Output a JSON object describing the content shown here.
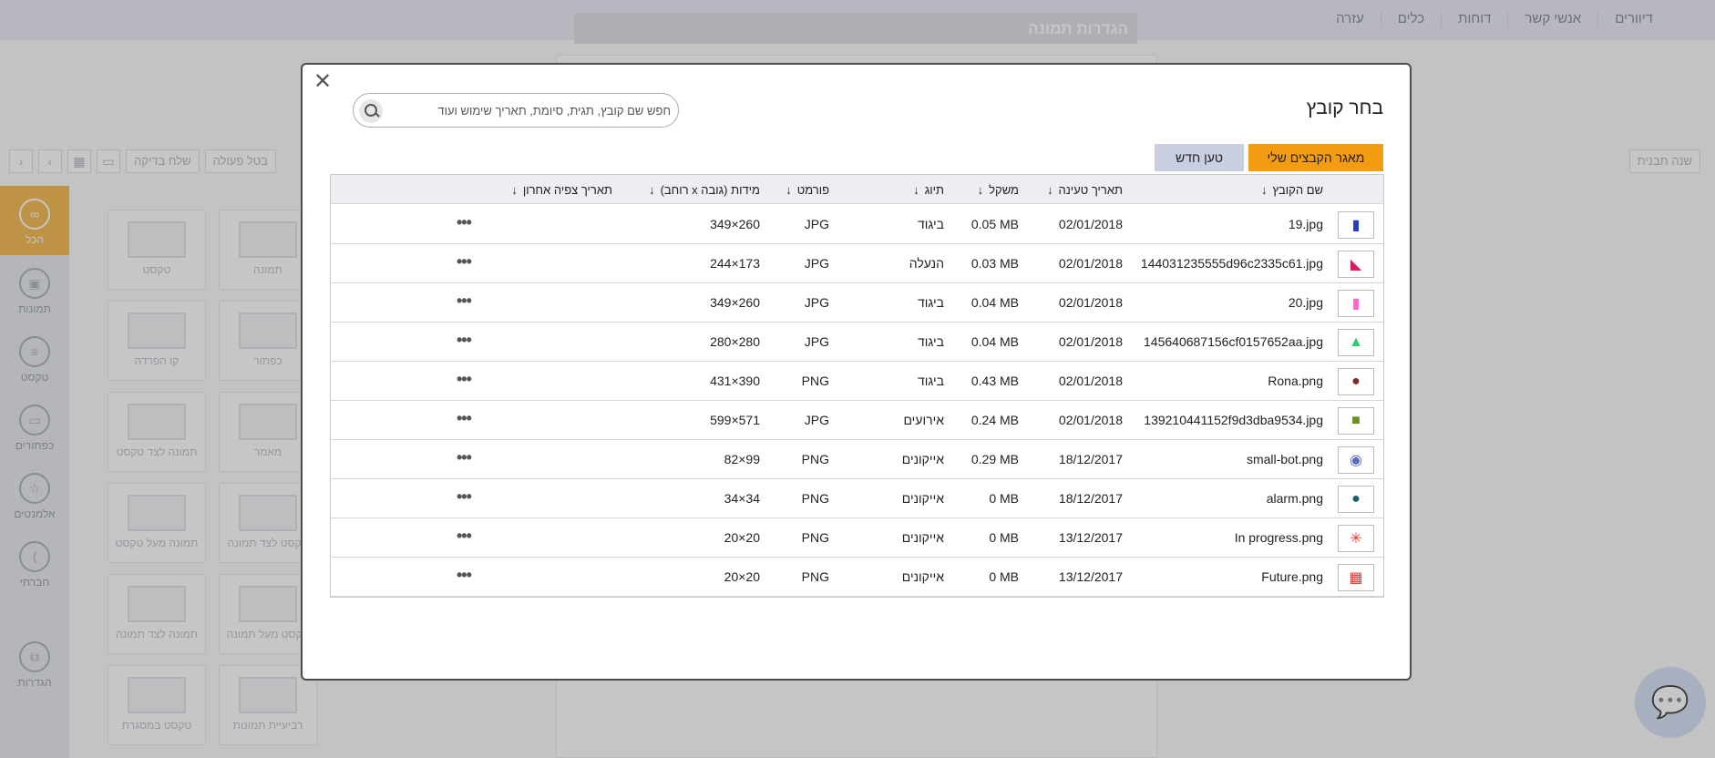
{
  "nav": [
    "דיוורים",
    "אנשי קשר",
    "דוחות",
    "כלים",
    "עזרה"
  ],
  "settings_panel_title": "הגדרות תמונה",
  "toolbar": {
    "test_send": "שלח בדיקה",
    "cancel_action": "בטל פעולה",
    "change_template": "שנה תבנית"
  },
  "rail": [
    {
      "label": "הכל",
      "icon": "infinity-icon"
    },
    {
      "label": "תמונות",
      "icon": "image-icon"
    },
    {
      "label": "טקסט",
      "icon": "text-icon"
    },
    {
      "label": "כפתורים",
      "icon": "button-icon"
    },
    {
      "label": "אלמנטים",
      "icon": "star-icon"
    },
    {
      "label": "חברתי",
      "icon": "share-icon"
    },
    {
      "label": "הגדרות",
      "icon": "settings-icon"
    }
  ],
  "widgets": [
    "תמונה",
    "טקסט",
    "כפתור",
    "קו הפרדה",
    "מאמר",
    "תמונה לצד טקסט",
    "טקסט לצד תמונה",
    "תמונה מעל טקסט",
    "טקסט מעל תמונה",
    "תמונה לצד תמונה",
    "רביעיית תמונות",
    "טקסט במסגרת"
  ],
  "modal": {
    "title": "בחר קובץ",
    "search_placeholder": "חפש שם קובץ, תגית, סיומת, תאריך שימוש ועוד",
    "btn_my_files": "מאגר הקבצים שלי",
    "btn_upload": "טען חדש",
    "columns": {
      "name": "שם הקובץ",
      "upload_date": "תאריך טעינה",
      "size": "משקל",
      "tag": "תיוג",
      "format": "פורמט",
      "dims": "מידות (גובה x רוחב)",
      "last_viewed": "תאריך צפיה אחרון"
    },
    "sort_arrow": "↓",
    "more": "•••",
    "rows": [
      {
        "name": "19.jpg",
        "date": "02/01/2018",
        "size": "0.05 MB",
        "tag": "ביגוד",
        "format": "JPG",
        "dims": "349×260",
        "thumb_color": "#1f3fbf",
        "thumb_glyph": "▮",
        "thumb_icon": "dress-icon"
      },
      {
        "name": "144031235555d96c2335c61.jpg",
        "date": "02/01/2018",
        "size": "0.03 MB",
        "tag": "הנעלה",
        "format": "JPG",
        "dims": "244×173",
        "thumb_color": "#d81b60",
        "thumb_glyph": "◣",
        "thumb_icon": "shoe-icon"
      },
      {
        "name": "20.jpg",
        "date": "02/01/2018",
        "size": "0.04 MB",
        "tag": "ביגוד",
        "format": "JPG",
        "dims": "349×260",
        "thumb_color": "#ff66cc",
        "thumb_glyph": "▮",
        "thumb_icon": "shirt-icon"
      },
      {
        "name": "145640687156cf0157652aa.jpg",
        "date": "02/01/2018",
        "size": "0.04 MB",
        "tag": "ביגוד",
        "format": "JPG",
        "dims": "280×280",
        "thumb_color": "#2ecc71",
        "thumb_glyph": "▲",
        "thumb_icon": "dress-icon"
      },
      {
        "name": "Rona.png",
        "date": "02/01/2018",
        "size": "0.43 MB",
        "tag": "ביגוד",
        "format": "PNG",
        "dims": "431×390",
        "thumb_color": "#7a2a2a",
        "thumb_glyph": "●",
        "thumb_icon": "portrait-icon"
      },
      {
        "name": "139210441152f9d3dba9534.jpg",
        "date": "02/01/2018",
        "size": "0.24 MB",
        "tag": "אירועים",
        "format": "JPG",
        "dims": "599×571",
        "thumb_color": "#6b8e23",
        "thumb_glyph": "■",
        "thumb_icon": "photo-icon"
      },
      {
        "name": "small-bot.png",
        "date": "18/12/2017",
        "size": "0.29 MB",
        "tag": "אייקונים",
        "format": "PNG",
        "dims": "82×99",
        "thumb_color": "#5c6bc0",
        "thumb_glyph": "◉",
        "thumb_icon": "bot-icon"
      },
      {
        "name": "alarm.png",
        "date": "18/12/2017",
        "size": "0 MB",
        "tag": "אייקונים",
        "format": "PNG",
        "dims": "34×34",
        "thumb_color": "#1e5d6b",
        "thumb_glyph": "●",
        "thumb_icon": "bell-icon"
      },
      {
        "name": "In progress.png",
        "date": "13/12/2017",
        "size": "0 MB",
        "tag": "אייקונים",
        "format": "PNG",
        "dims": "20×20",
        "thumb_color": "#e53935",
        "thumb_glyph": "✳",
        "thumb_icon": "spinner-icon"
      },
      {
        "name": "Future.png",
        "date": "13/12/2017",
        "size": "0 MB",
        "tag": "אייקונים",
        "format": "PNG",
        "dims": "20×20",
        "thumb_color": "#e53935",
        "thumb_glyph": "▦",
        "thumb_icon": "calendar-clock-icon"
      }
    ]
  }
}
